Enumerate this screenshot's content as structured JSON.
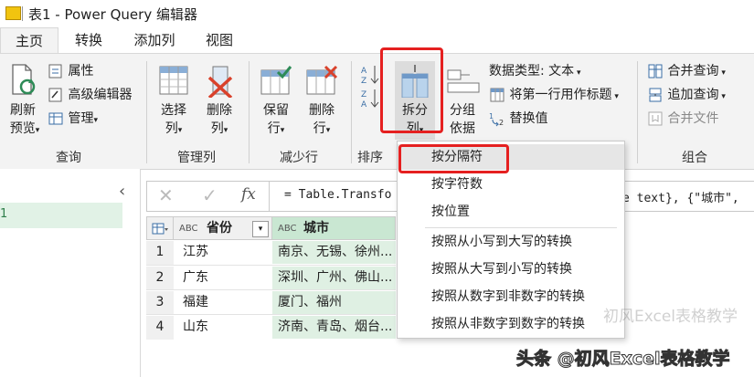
{
  "window": {
    "title": "表1 - Power Query 编辑器"
  },
  "tabs": [
    {
      "label": "主页"
    },
    {
      "label": "转换"
    },
    {
      "label": "添加列"
    },
    {
      "label": "视图"
    }
  ],
  "ribbon": {
    "query_group": {
      "refresh_label": "刷新",
      "refresh_label2": "预览",
      "properties": "属性",
      "advanced_editor": "高级编辑器",
      "manage": "管理",
      "group_label": "查询"
    },
    "manage_columns": {
      "choose_label": "选择",
      "choose_label2": "列",
      "remove_label": "删除",
      "remove_label2": "列",
      "group_label": "管理列"
    },
    "reduce_rows": {
      "keep_label": "保留",
      "keep_label2": "行",
      "remove_label": "删除",
      "remove_label2": "行",
      "group_label": "减少行"
    },
    "sort": {
      "group_label": "排序"
    },
    "transform": {
      "split_label": "拆分",
      "split_label2": "列",
      "groupby_label": "分组",
      "groupby_label2": "依据",
      "data_type": "数据类型: 文本",
      "first_row_header": "将第一行用作标题",
      "replace_values": "替换值"
    },
    "combine": {
      "merge_queries": "合并查询",
      "append_queries": "追加查询",
      "combine_files": "合并文件",
      "group_label": "组合"
    }
  },
  "formula_bar": {
    "fx": "fx",
    "text_left": "= Table.Transfo",
    "text_right": "e text}, {\"城市\", "
  },
  "table": {
    "columns": [
      {
        "type_icon": "ABC",
        "name": "省份"
      },
      {
        "type_icon": "ABC",
        "name": "城市"
      }
    ],
    "rows": [
      {
        "num": "1",
        "province": "江苏",
        "city": "南京、无锡、徐州..."
      },
      {
        "num": "2",
        "province": "广东",
        "city": "深圳、广州、佛山..."
      },
      {
        "num": "3",
        "province": "福建",
        "city": "厦门、福州"
      },
      {
        "num": "4",
        "province": "山东",
        "city": "济南、青岛、烟台..."
      }
    ]
  },
  "split_menu": {
    "items": [
      {
        "label": "按分隔符"
      },
      {
        "label": "按字符数"
      },
      {
        "label": "按位置"
      },
      {
        "label": "按照从小写到大写的转换"
      },
      {
        "label": "按照从大写到小写的转换"
      },
      {
        "label": "按照从数字到非数字的转换"
      },
      {
        "label": "按照从非数字到数字的转换"
      }
    ]
  },
  "watermark": {
    "faint": "初风Excel表格教学",
    "main": "头条 @初风Excel表格教学"
  },
  "colors": {
    "highlight_red": "#e52020",
    "selected_column_green": "#dff0e3",
    "ribbon_bg": "#f3f3f3"
  }
}
